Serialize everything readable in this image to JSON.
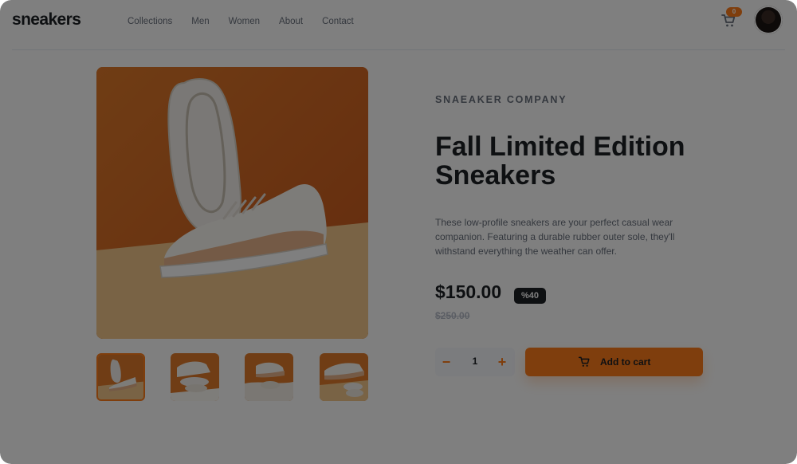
{
  "brand": {
    "logo": "sneakers"
  },
  "nav": {
    "items": [
      "Collections",
      "Men",
      "Women",
      "About",
      "Contact"
    ]
  },
  "cart": {
    "count": "0",
    "icon": "cart-icon"
  },
  "user": {
    "avatar": "avatar"
  },
  "product": {
    "company": "SNAEAKER COMPANY",
    "title": "Fall Limited Edition Sneakers",
    "description": "These low-profile sneakers are your perfect casual wear companion. Featuring a durable rubber outer sole, they'll withstand everything the weather can offer.",
    "price": "$150.00",
    "discount": "%40",
    "old_price": "$250.00",
    "quantity": "1",
    "minus": "−",
    "plus": "+",
    "add_to_cart": "Add to cart"
  },
  "gallery": {
    "thumbnails": [
      "thumbnail-1",
      "thumbnail-2",
      "thumbnail-3",
      "thumbnail-4"
    ],
    "active_index": 0
  },
  "colors": {
    "accent": "#ff7d1a",
    "dark": "#1d2025",
    "text_muted": "#69707d",
    "overlay": "rgba(0,0,0,0.5)"
  }
}
